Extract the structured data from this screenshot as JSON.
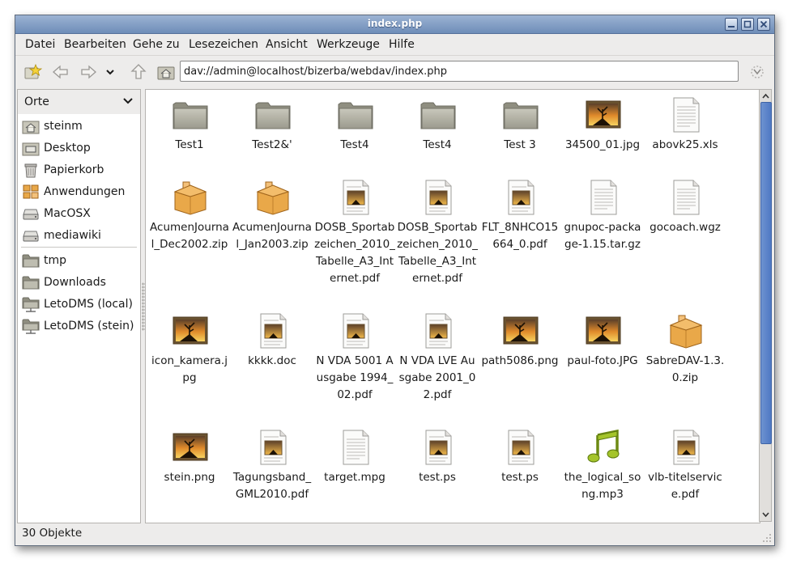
{
  "window": {
    "title": "index.php"
  },
  "menu": [
    "Datei",
    "Bearbeiten",
    "Gehe zu",
    "Lesezeichen",
    "Ansicht",
    "Werkzeuge",
    "Hilfe"
  ],
  "location": {
    "value": "dav://admin@localhost/bizerba/webdav/index.php"
  },
  "sidebar": {
    "title": "Orte",
    "items": [
      {
        "label": "steinm",
        "icon": "home-icon"
      },
      {
        "label": "Desktop",
        "icon": "desktop-icon"
      },
      {
        "label": "Papierkorb",
        "icon": "trash-icon"
      },
      {
        "label": "Anwendungen",
        "icon": "applications-icon"
      },
      {
        "label": "MacOSX",
        "icon": "drive-icon"
      },
      {
        "label": "mediawiki",
        "icon": "drive-icon"
      },
      {
        "label": "tmp",
        "icon": "folder-icon"
      },
      {
        "label": "Downloads",
        "icon": "folder-icon"
      },
      {
        "label": "LetoDMS (local)",
        "icon": "network-folder-icon"
      },
      {
        "label": "LetoDMS (stein)",
        "icon": "network-folder-icon"
      }
    ]
  },
  "files": [
    {
      "name": "Test1",
      "type": "folder"
    },
    {
      "name": "Test2&'",
      "type": "folder"
    },
    {
      "name": "Test4",
      "type": "folder"
    },
    {
      "name": "Test4",
      "type": "folder"
    },
    {
      "name": "Test 3",
      "type": "folder"
    },
    {
      "name": "34500_01.jpg",
      "type": "image"
    },
    {
      "name": "abovk25.xls",
      "type": "text"
    },
    {
      "name": "AcumenJournal_Dec2002.zip",
      "type": "archive"
    },
    {
      "name": "AcumenJournal_Jan2003.zip",
      "type": "archive"
    },
    {
      "name": "DOSB_Sportabzeichen_2010_Tabelle_A3_Internet.pdf",
      "type": "document"
    },
    {
      "name": "DOSB_Sportabzeichen_2010_Tabelle_A3_Internet.pdf",
      "type": "document"
    },
    {
      "name": "FLT_8NHCO15664_0.pdf",
      "type": "document"
    },
    {
      "name": "gnupoc-package-1.15.tar.gz",
      "type": "text"
    },
    {
      "name": "gocoach.wgz",
      "type": "text"
    },
    {
      "name": "icon_kamera.jpg",
      "type": "image"
    },
    {
      "name": "kkkk.doc",
      "type": "document"
    },
    {
      "name": "N VDA 5001 Ausgabe 1994_02.pdf",
      "type": "document"
    },
    {
      "name": "N VDA LVE Ausgabe 2001_02.pdf",
      "type": "document"
    },
    {
      "name": "path5086.png",
      "type": "image"
    },
    {
      "name": "paul-foto.JPG",
      "type": "image"
    },
    {
      "name": "SabreDAV-1.3.0.zip",
      "type": "archive"
    },
    {
      "name": "stein.png",
      "type": "image"
    },
    {
      "name": "Tagungsband_GML2010.pdf",
      "type": "document"
    },
    {
      "name": "target.mpg",
      "type": "text"
    },
    {
      "name": "test.ps",
      "type": "document"
    },
    {
      "name": "test.ps",
      "type": "document"
    },
    {
      "name": "the_logical_song.mp3",
      "type": "audio"
    },
    {
      "name": "vlb-titelservice.pdf",
      "type": "document"
    }
  ],
  "status": {
    "text": "30 Objekte"
  },
  "colors": {
    "titlebar": "#7f9bc4",
    "selection": "#4f79c4",
    "folder": "#a8a79a"
  }
}
